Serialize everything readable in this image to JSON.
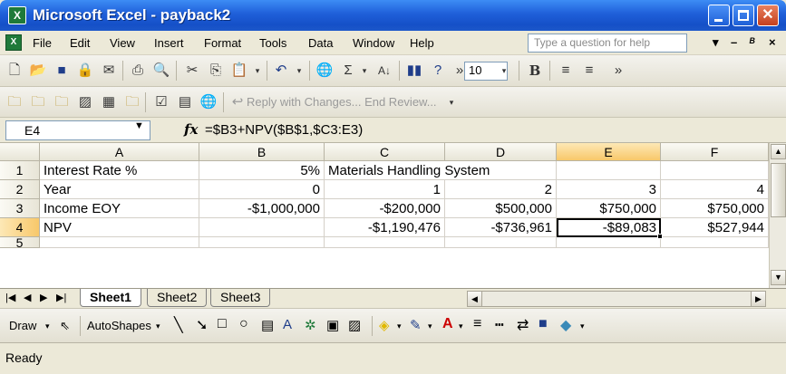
{
  "window": {
    "title": "Microsoft Excel - payback2",
    "min_label": "–",
    "max_label": "□",
    "close_label": "×"
  },
  "menu": {
    "items": [
      "File",
      "Edit",
      "View",
      "Insert",
      "Format",
      "Tools",
      "Data",
      "Window",
      "Help"
    ],
    "help_placeholder": "Type a question for help"
  },
  "toolbar": {
    "font_size": "10",
    "reply_text": "Reply with Changes... End Review..."
  },
  "formula_bar": {
    "name_box": "E4",
    "fx": "fx",
    "formula": "=$B3+NPV($B$1,$C3:E3)"
  },
  "grid": {
    "columns": [
      "A",
      "B",
      "C",
      "D",
      "E",
      "F"
    ],
    "rows": [
      "1",
      "2",
      "3",
      "4",
      "5"
    ],
    "cells": {
      "A1": "Interest Rate %",
      "B1": "5%",
      "C1": "Materials Handling System",
      "A2": "Year",
      "B2": "0",
      "C2": "1",
      "D2": "2",
      "E2": "3",
      "F2": "4",
      "A3": "Income EOY",
      "B3": "-$1,000,000",
      "C3": "-$200,000",
      "D3": "$500,000",
      "E3": "$750,000",
      "F3": "$750,000",
      "A4": "NPV",
      "C4": "-$1,190,476",
      "D4": "-$736,961",
      "E4": "-$89,083",
      "F4": "$527,944"
    }
  },
  "sheets": [
    "Sheet1",
    "Sheet2",
    "Sheet3"
  ],
  "active_sheet": "Sheet1",
  "drawing": {
    "draw_label": "Draw",
    "autoshapes_label": "AutoShapes"
  },
  "status": "Ready"
}
